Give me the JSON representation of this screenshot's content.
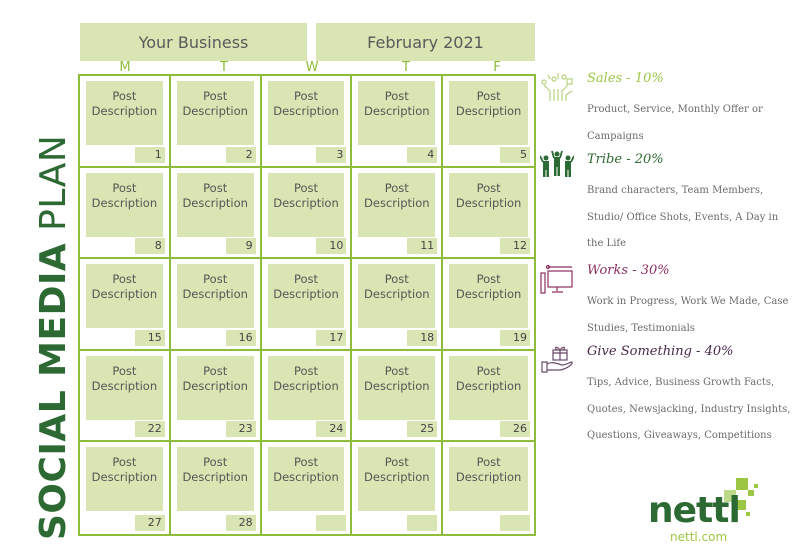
{
  "header": {
    "business": "Your Business",
    "month": "February 2021"
  },
  "side_title": {
    "bold": "SOCIAL MEDIA",
    "light": "PLAN"
  },
  "days": [
    "M",
    "T",
    "W",
    "T",
    "F"
  ],
  "post_label_line1": "Post",
  "post_label_line2": "Description",
  "calendar": {
    "dates": [
      "1",
      "2",
      "3",
      "4",
      "5",
      "8",
      "9",
      "10",
      "11",
      "12",
      "15",
      "16",
      "17",
      "18",
      "19",
      "22",
      "23",
      "24",
      "25",
      "26",
      "27",
      "28",
      "",
      "",
      ""
    ]
  },
  "legend": [
    {
      "icon": "circuit-hand-icon",
      "title": "Sales - 10%",
      "color": "#9cc644",
      "desc": "Product, Service, Monthly Offer or Campaigns"
    },
    {
      "icon": "people-cheering-icon",
      "title": "Tribe - 20%",
      "color": "#2d6a33",
      "desc": "Brand characters, Team Members, Studio/ Office Shots, Events, A Day in the Life"
    },
    {
      "icon": "computer-design-icon",
      "title": "Works - 30%",
      "color": "#8a2f62",
      "desc": "Work in Progress, Work We Made, Case Studies, Testimonials"
    },
    {
      "icon": "gift-hand-icon",
      "title": "Give Something - 40%",
      "color": "#4a2a4a",
      "desc": "Tips, Advice, Business Growth Facts, Quotes, Newsjacking, Industry Insights, Questions, Giveaways, Competitions"
    }
  ],
  "logo": {
    "word": "nettl",
    "url": "nettl.com"
  },
  "colors": {
    "accent_green": "#8dbd3a",
    "box_fill": "#dae5b4",
    "title_green": "#2d6a33"
  }
}
